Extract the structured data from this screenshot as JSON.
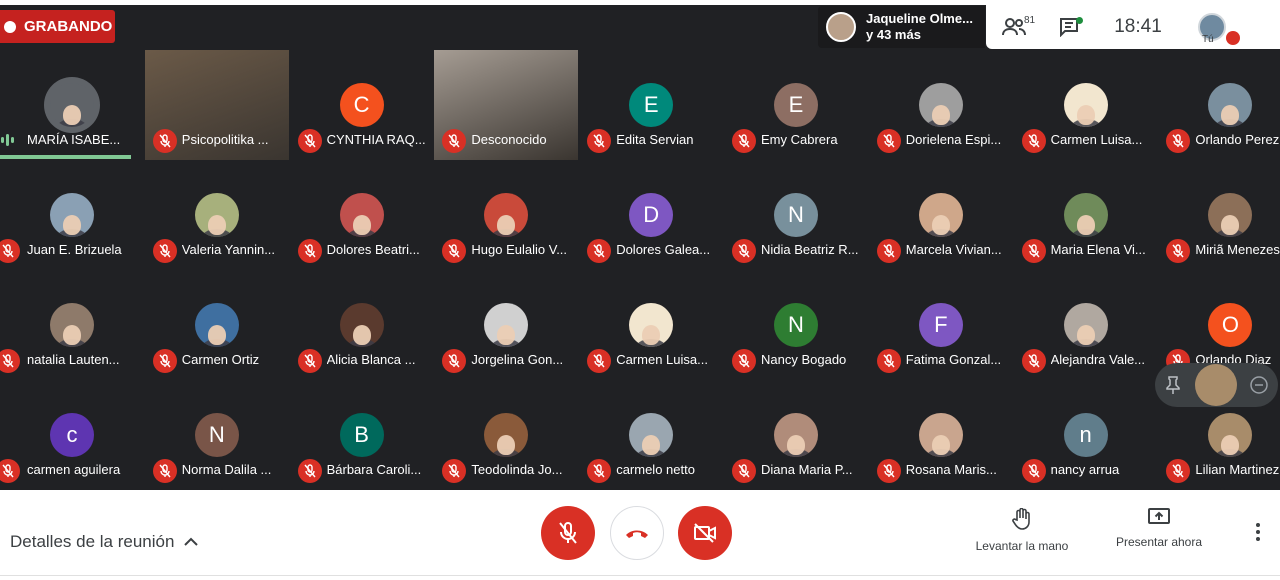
{
  "recording": {
    "label": "GRABANDO"
  },
  "presenter": {
    "name": "Jaqueline Olme...",
    "sub": "y 43 más"
  },
  "top_controls": {
    "people_count": "81",
    "clock": "18:41",
    "self_label": "Tú"
  },
  "participants": [
    {
      "name": "MARÍA ISABE...",
      "initial": "",
      "color": "#5f6368",
      "kind": "photo",
      "speaking": true
    },
    {
      "name": "Psicopolitika ...",
      "initial": "",
      "color": "#6b5a48",
      "kind": "video"
    },
    {
      "name": "CYNTHIA RAQ...",
      "initial": "C",
      "color": "#f4511e",
      "kind": "initial"
    },
    {
      "name": "Desconocido",
      "initial": "",
      "color": "#a59c93",
      "kind": "video"
    },
    {
      "name": "Edita Servian",
      "initial": "E",
      "color": "#00897b",
      "kind": "initial"
    },
    {
      "name": "Emy Cabrera",
      "initial": "E",
      "color": "#8d6e63",
      "kind": "initial"
    },
    {
      "name": "Dorielena Espi...",
      "initial": "",
      "color": "#9e9e9e",
      "kind": "photo"
    },
    {
      "name": "Carmen Luisa...",
      "initial": "",
      "color": "#f2e6cf",
      "kind": "photo"
    },
    {
      "name": "Orlando Perez",
      "initial": "",
      "color": "#7a8f9e",
      "kind": "photo"
    },
    {
      "name": "Juan E. Brizuela",
      "initial": "",
      "color": "#8aa0b4",
      "kind": "photo"
    },
    {
      "name": "Valeria Yannin...",
      "initial": "",
      "color": "#a7b07c",
      "kind": "photo"
    },
    {
      "name": "Dolores Beatri...",
      "initial": "",
      "color": "#c0504d",
      "kind": "photo"
    },
    {
      "name": "Hugo Eulalio V...",
      "initial": "",
      "color": "#c94a3a",
      "kind": "photo"
    },
    {
      "name": "Dolores Galea...",
      "initial": "D",
      "color": "#7e57c2",
      "kind": "initial"
    },
    {
      "name": "Nidia Beatriz R...",
      "initial": "N",
      "color": "#78909c",
      "kind": "initial"
    },
    {
      "name": "Marcela Vivian...",
      "initial": "",
      "color": "#cfa78a",
      "kind": "photo"
    },
    {
      "name": "Maria Elena Vi...",
      "initial": "",
      "color": "#6f8b5a",
      "kind": "photo"
    },
    {
      "name": "Miriã Menezes",
      "initial": "",
      "color": "#8c6f58",
      "kind": "photo"
    },
    {
      "name": "natalia Lauten...",
      "initial": "",
      "color": "#8e7a6a",
      "kind": "photo"
    },
    {
      "name": "Carmen Ortiz",
      "initial": "",
      "color": "#3f6fa0",
      "kind": "photo"
    },
    {
      "name": "Alicia Blanca ...",
      "initial": "",
      "color": "#5a3a2e",
      "kind": "photo"
    },
    {
      "name": "Jorgelina Gon...",
      "initial": "",
      "color": "#d0d0d0",
      "kind": "photo"
    },
    {
      "name": "Carmen Luisa...",
      "initial": "",
      "color": "#f2e6cf",
      "kind": "photo"
    },
    {
      "name": "Nancy Bogado",
      "initial": "N",
      "color": "#2e7d32",
      "kind": "initial"
    },
    {
      "name": "Fatima Gonzal...",
      "initial": "F",
      "color": "#7e57c2",
      "kind": "initial"
    },
    {
      "name": "Alejandra Vale...",
      "initial": "",
      "color": "#b0a8a0",
      "kind": "photo"
    },
    {
      "name": "Orlando Diaz",
      "initial": "O",
      "color": "#f4511e",
      "kind": "initial"
    },
    {
      "name": "carmen aguilera",
      "initial": "c",
      "color": "#5e35b1",
      "kind": "initial"
    },
    {
      "name": "Norma Dalila ...",
      "initial": "N",
      "color": "#795548",
      "kind": "initial"
    },
    {
      "name": "Bárbara Caroli...",
      "initial": "B",
      "color": "#00695c",
      "kind": "initial"
    },
    {
      "name": "Teodolinda Jo...",
      "initial": "",
      "color": "#8a5a3a",
      "kind": "photo"
    },
    {
      "name": "carmelo netto",
      "initial": "",
      "color": "#9aa6b0",
      "kind": "photo"
    },
    {
      "name": "Diana Maria P...",
      "initial": "",
      "color": "#b08c7a",
      "kind": "photo"
    },
    {
      "name": "Rosana Maris...",
      "initial": "",
      "color": "#c9a58e",
      "kind": "photo"
    },
    {
      "name": "nancy arrua",
      "initial": "n",
      "color": "#607d8b",
      "kind": "initial"
    },
    {
      "name": "Lilian Martinez",
      "initial": "",
      "color": "#a88c6a",
      "kind": "photo"
    }
  ],
  "bottom": {
    "details_label": "Detalles de la reunión",
    "raise_hand_label": "Levantar la mano",
    "present_label": "Presentar ahora"
  },
  "colors": {
    "recording_red": "#c5221f",
    "danger_red": "#d93025",
    "background": "#202124",
    "speaking_green": "#81c995"
  }
}
